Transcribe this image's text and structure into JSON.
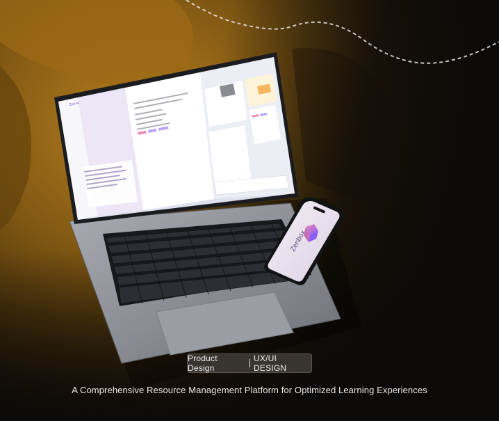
{
  "badge": {
    "category": "Product Design",
    "discipline": "UX/UI DESIGN"
  },
  "tagline": "A Comprehensive Resource Management Platform for Optimized Learning Experiences",
  "phone": {
    "brand": "Zenbox"
  },
  "laptop_screen": {
    "app_name": "Zen AI"
  },
  "colors": {
    "background": "#0c0a08",
    "couch": "#8a5a12",
    "laptop_body": "#8f9298",
    "keys": "#222428",
    "accent": "#8b5cf6"
  }
}
